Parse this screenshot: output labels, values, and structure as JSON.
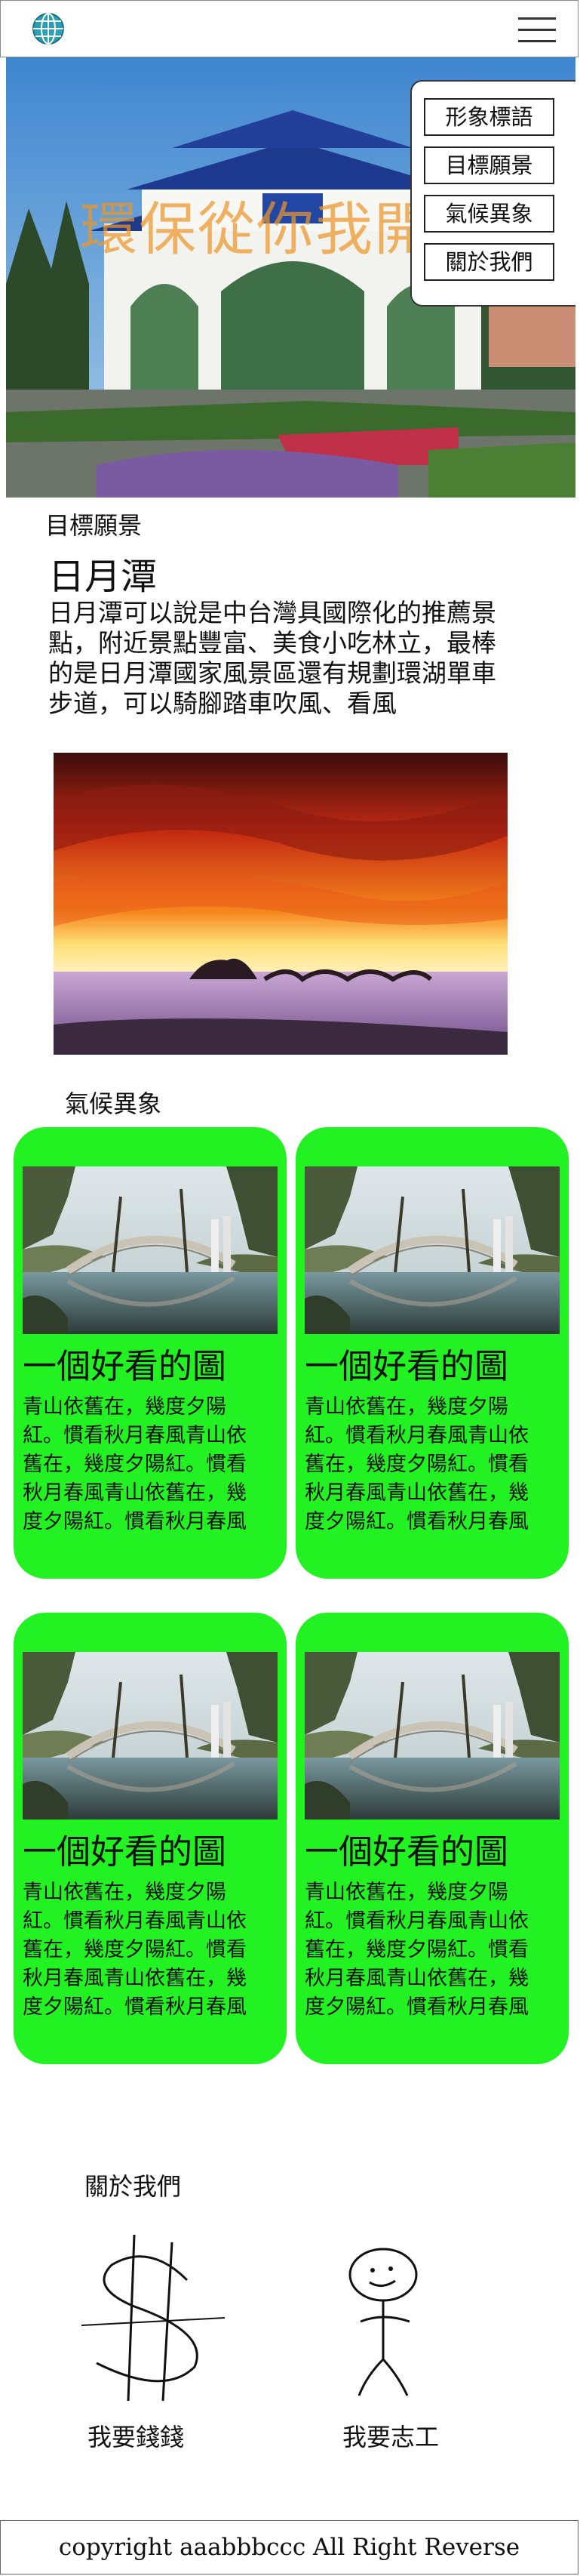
{
  "nav": {
    "items": [
      "形象標語",
      "目標願景",
      "氣候異象",
      "關於我們"
    ]
  },
  "hero": {
    "slogan": "環保從你我開始"
  },
  "goals": {
    "heading": "目標願景",
    "place_title": "日月潭",
    "description": "日月潭可以說是中台灣具國際化的推薦景點，附近景點豐富、美食小吃林立，最棒的是日月潭國家風景區還有規劃環湖單車步道，可以騎腳踏車吹風、看風"
  },
  "climate": {
    "heading": "氣候異象",
    "cards": [
      {
        "title": "一個好看的圖",
        "text": "青山依舊在，幾度夕陽紅。慣看秋月春風青山依舊在，幾度夕陽紅。慣看秋月春風青山依舊在，幾度夕陽紅。慣看秋月春風"
      },
      {
        "title": "一個好看的圖",
        "text": "青山依舊在，幾度夕陽紅。慣看秋月春風青山依舊在，幾度夕陽紅。慣看秋月春風青山依舊在，幾度夕陽紅。慣看秋月春風"
      },
      {
        "title": "一個好看的圖",
        "text": "青山依舊在，幾度夕陽紅。慣看秋月春風青山依舊在，幾度夕陽紅。慣看秋月春風青山依舊在，幾度夕陽紅。慣看秋月春風"
      },
      {
        "title": "一個好看的圖",
        "text": "青山依舊在，幾度夕陽紅。慣看秋月春風青山依舊在，幾度夕陽紅。慣看秋月春風青山依舊在，幾度夕陽紅。慣看秋月春風"
      }
    ]
  },
  "about": {
    "heading": "關於我們",
    "left_caption": "我要錢錢",
    "right_caption": "我要志工"
  },
  "footer": {
    "copyright": "copyright aaabbbccc All Right Reverse"
  },
  "colors": {
    "card_background": "#22f122",
    "slogan": "#eb9628"
  },
  "icons": [
    "globe-icon",
    "hamburger-icon"
  ]
}
